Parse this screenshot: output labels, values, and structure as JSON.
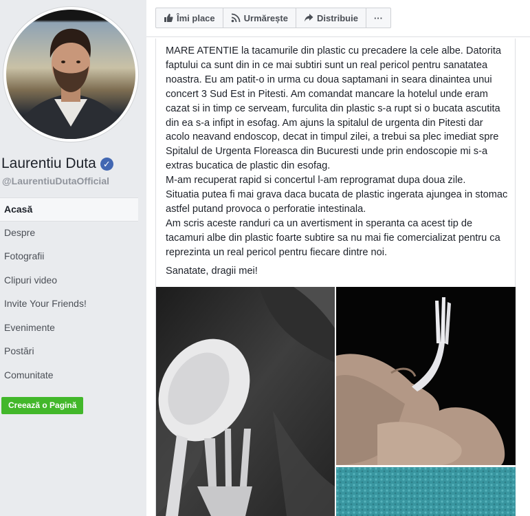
{
  "sidebar": {
    "page_name": "Laurentiu Duta",
    "handle": "@LaurentiuDutaOfficial",
    "verified_mark": "✓",
    "nav": [
      {
        "label": "Acasă"
      },
      {
        "label": "Despre"
      },
      {
        "label": "Fotografii"
      },
      {
        "label": "Clipuri video"
      },
      {
        "label": "Invite Your Friends!"
      },
      {
        "label": "Evenimente"
      },
      {
        "label": "Postări"
      },
      {
        "label": "Comunitate"
      }
    ],
    "create_page_label": "Creează o Pagină"
  },
  "toolbar": {
    "like_label": "Îmi place",
    "follow_label": "Urmărește",
    "share_label": "Distribuie",
    "more_label": "···"
  },
  "post": {
    "paragraph_1": "MARE ATENTIE la tacamurile din plastic cu precadere la cele albe. Datorita faptului ca sunt din in ce mai subtiri sunt un real pericol pentru sanatatea noastra. Eu am patit-o in urma cu doua saptamani in seara dinaintea unui concert 3 Sud Est in Pitesti. Am comandat mancare la hotelul unde eram cazat si in timp ce serveam, furculita din plastic s-a rupt si o bucata ascutita din ea s-a infipt in esofag. Am ajuns la spitalul de urgenta din Pitesti dar acolo neavand endoscop, decat in timpul zilei, a trebui sa plec imediat spre Spitalul de Urgenta Floreasca din Bucuresti unde prin endoscopie mi s-a extras bucatica de plastic din esofag.",
    "paragraph_2": "M-am recuperat rapid si concertul l-am reprogramat dupa doua zile.",
    "paragraph_3": "Situatia putea fi mai grava daca bucata de plastic ingerata ajungea in stomac astfel putand provoca o perforatie intestinala.",
    "paragraph_4": "Am scris aceste randuri ca un avertisment in speranta ca acest tip de tacamuri albe din plastic foarte subtire sa nu mai fie comercializat pentru ca reprezinta un real pericol pentru fiecare dintre noi.",
    "closing": "Sanatate, dragii mei!"
  },
  "colors": {
    "brand": "#4267b2",
    "green_button": "#42b72a",
    "background": "#e9ebee"
  }
}
